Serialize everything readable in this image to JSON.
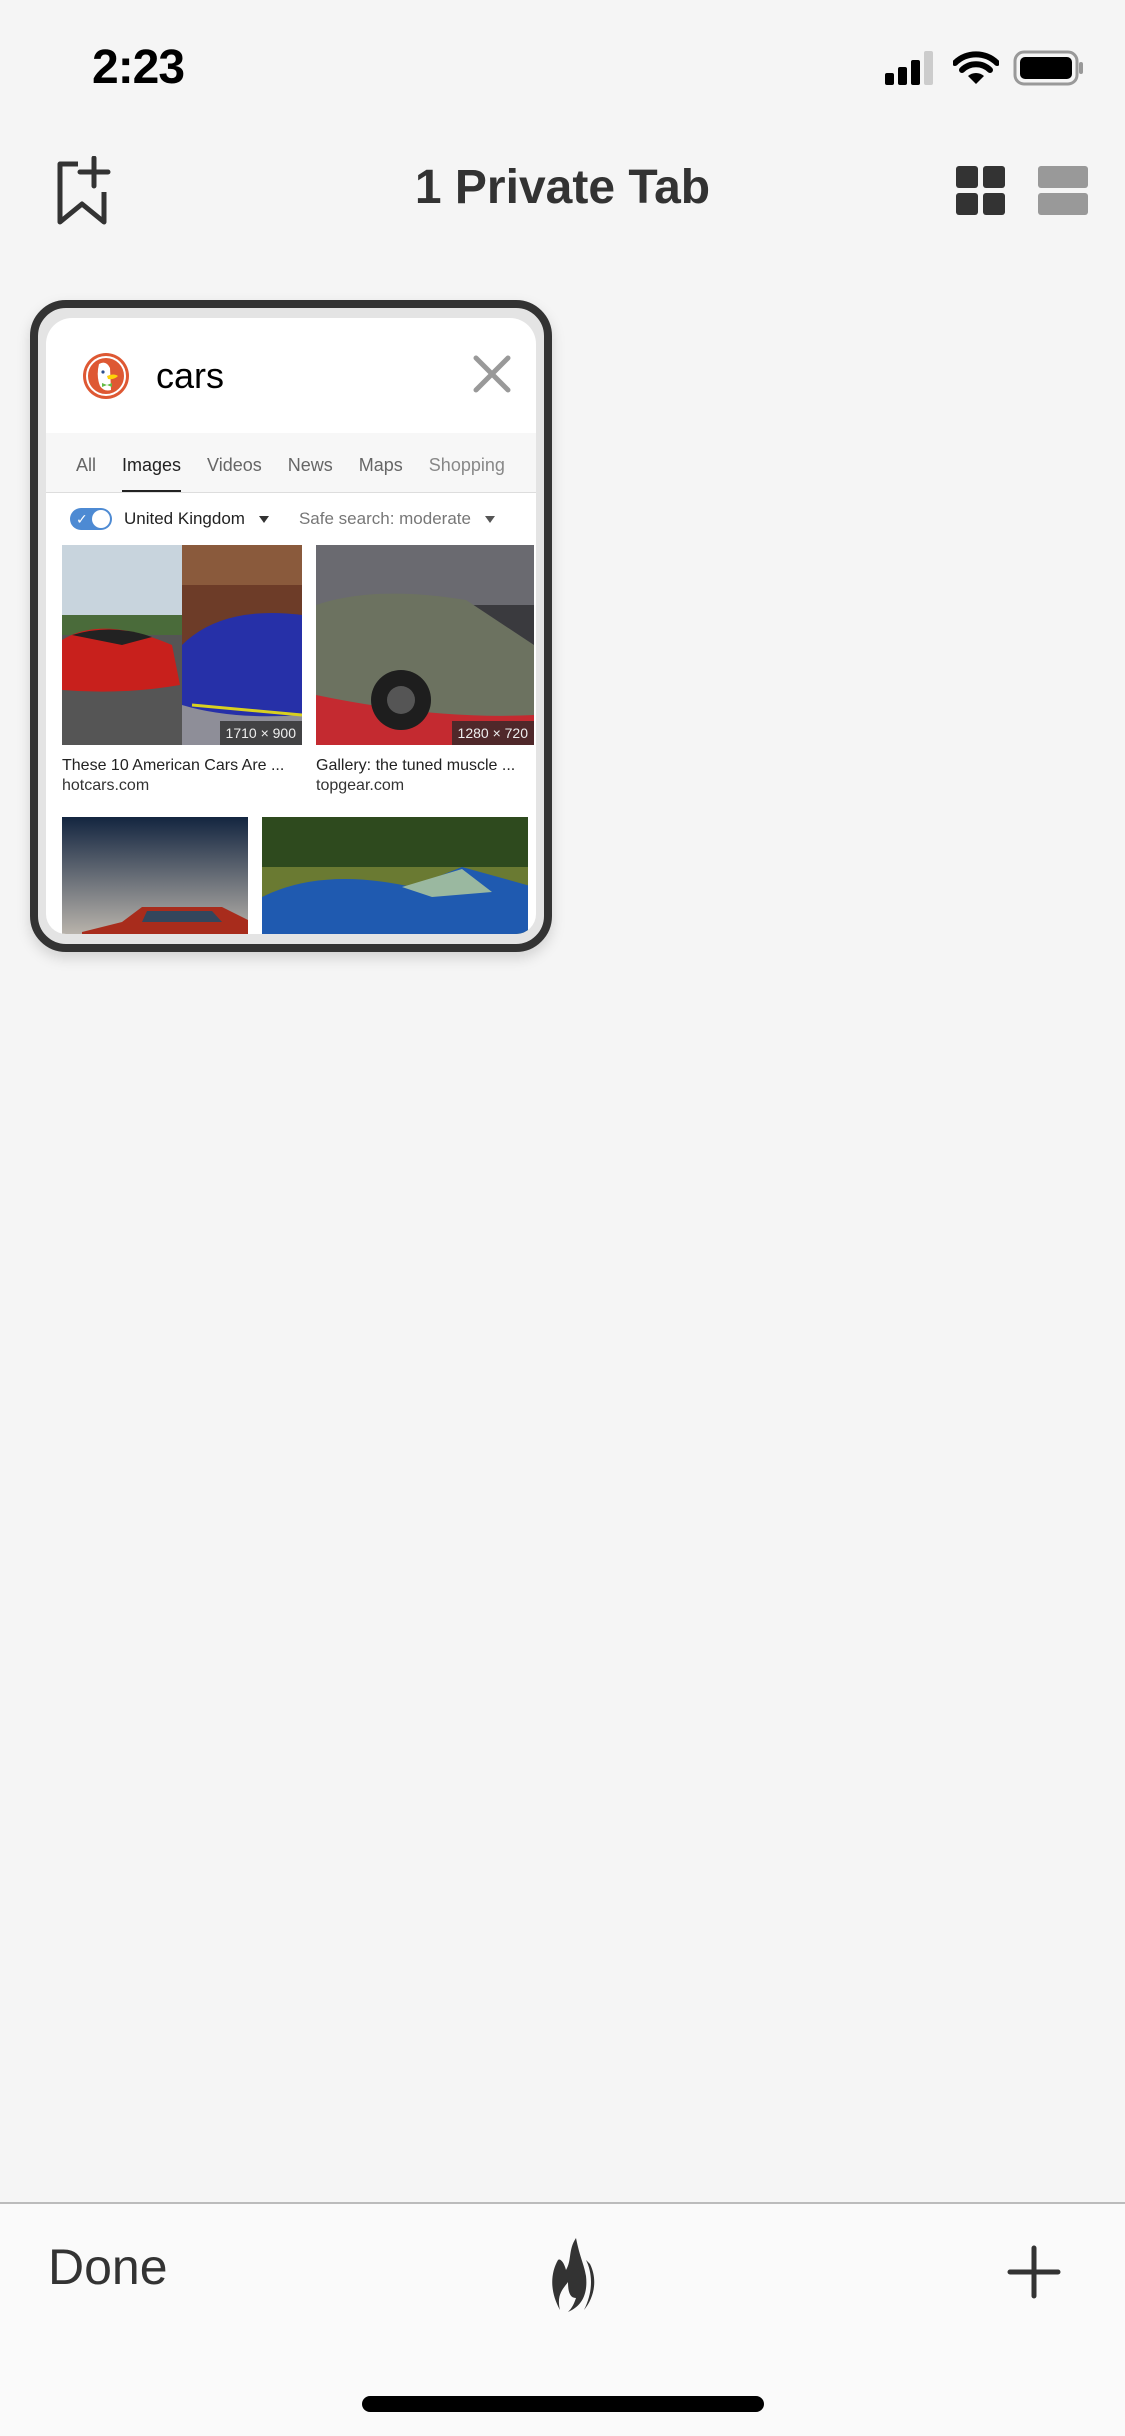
{
  "status_bar": {
    "time": "2:23",
    "icons": [
      "cellular-signal-icon",
      "wifi-icon",
      "battery-icon"
    ]
  },
  "header": {
    "title": "1 Private Tab",
    "left_button": "bookmark-add-icon",
    "view_toggle": [
      "grid-view-icon",
      "list-view-icon"
    ],
    "active_view": "grid"
  },
  "tabs": [
    {
      "title": "cars",
      "favicon": "duckduckgo-icon",
      "search_tabs": [
        {
          "label": "All",
          "active": false
        },
        {
          "label": "Images",
          "active": true
        },
        {
          "label": "Videos",
          "active": false
        },
        {
          "label": "News",
          "active": false
        },
        {
          "label": "Maps",
          "active": false
        },
        {
          "label": "Shopping",
          "active": false
        }
      ],
      "filters": {
        "region_toggle_on": true,
        "region": "United Kingdom",
        "safe_search": "Safe search: moderate"
      },
      "results": [
        {
          "caption": "These 10 American Cars Are ...",
          "source": "hotcars.com",
          "dimensions": "1710 × 900"
        },
        {
          "caption": "Gallery: the tuned muscle ...",
          "source": "topgear.com",
          "dimensions": "1280 × 720"
        }
      ]
    }
  ],
  "toolbar": {
    "done_label": "Done",
    "fire_icon": "fire-icon",
    "add_icon": "plus-icon"
  },
  "colors": {
    "background": "#f5f5f5",
    "accent_toggle": "#4d8ad3",
    "ddg_orange": "#de5833",
    "text_dark": "#333333"
  }
}
